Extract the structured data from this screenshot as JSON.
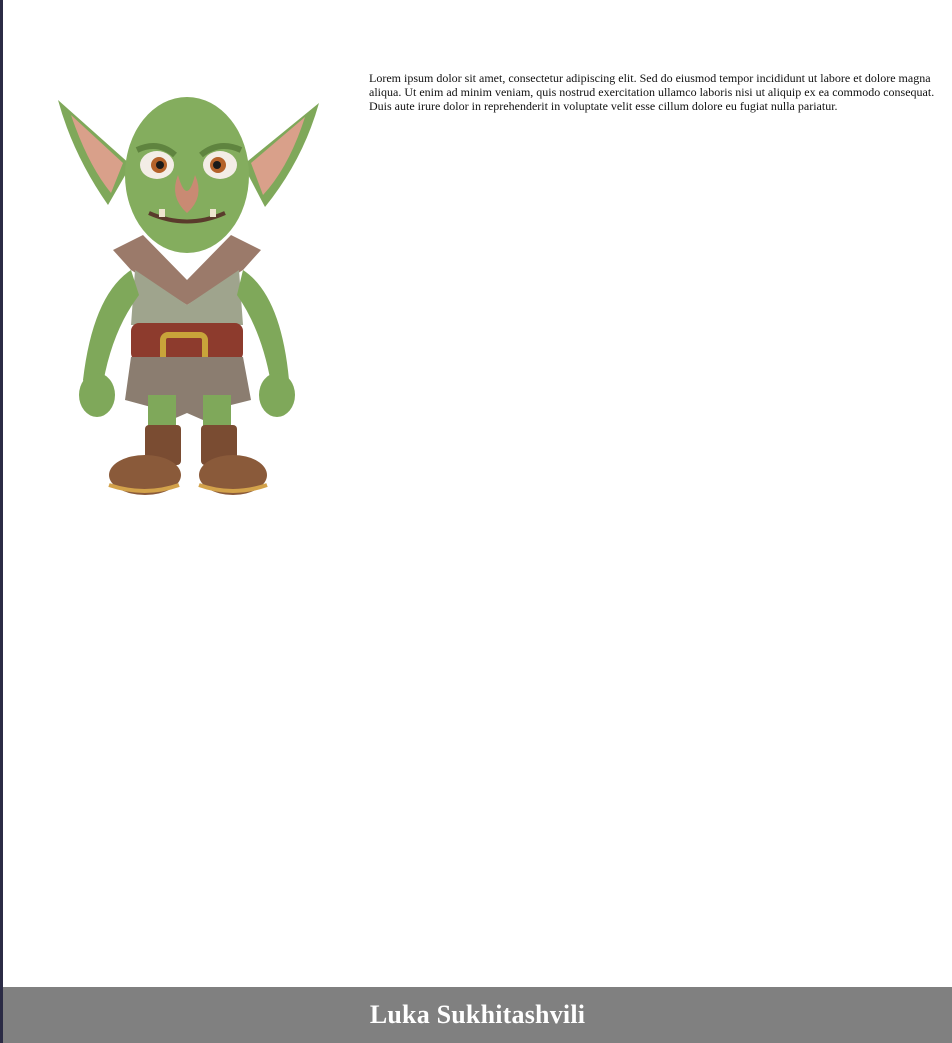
{
  "main": {
    "image": {
      "icon": "goblin-illustration"
    },
    "paragraph": "Lorem ipsum dolor sit amet, consectetur adipiscing elit. Sed do eiusmod tempor incididunt ut labore et dolore magna aliqua. Ut enim ad minim veniam, quis nostrud exercitation ullamco laboris nisi ut aliquip ex ea commodo consequat. Duis aute irure dolor in reprehenderit in voluptate velit esse cillum dolore eu fugiat nulla pariatur."
  },
  "footer": {
    "title": "Luka Sukhitashvili",
    "background": "#808080"
  }
}
